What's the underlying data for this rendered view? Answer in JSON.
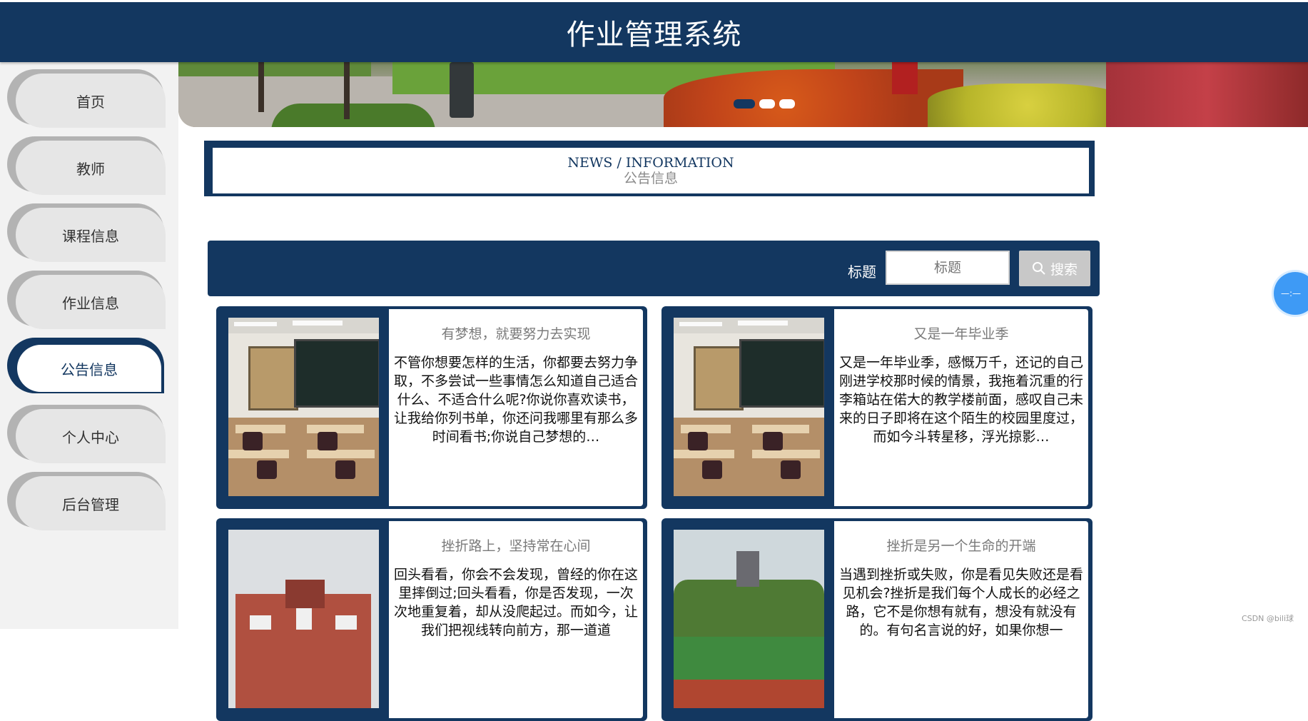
{
  "header": {
    "title": "作业管理系统"
  },
  "sidebar": {
    "items": [
      {
        "label": "首页",
        "active": false
      },
      {
        "label": "教师",
        "active": false
      },
      {
        "label": "课程信息",
        "active": false
      },
      {
        "label": "作业信息",
        "active": false
      },
      {
        "label": "公告信息",
        "active": true
      },
      {
        "label": "个人中心",
        "active": false
      },
      {
        "label": "后台管理",
        "active": false
      }
    ]
  },
  "banner": {
    "slide_count": 3,
    "active_slide": 1
  },
  "section": {
    "title_en": "NEWS / INFORMATION",
    "title_cn": "公告信息"
  },
  "search": {
    "label": "标题",
    "placeholder": "标题",
    "button_label": "搜索",
    "button_icon": "search-icon"
  },
  "cards": [
    {
      "title": "有梦想，就要努力去实现",
      "body": "不管你想要怎样的生活，你都要去努力争取，不多尝试一些事情怎么知道自己适合什么、不适合什么呢?你说你喜欢读书，让我给你列书单，你还问我哪里有那么多时间看书;你说自己梦想的…",
      "image": "classroom"
    },
    {
      "title": "又是一年毕业季",
      "body": "又是一年毕业季，感慨万千，还记的自己刚进学校那时候的情景，我拖着沉重的行李箱站在偌大的教学楼前面，感叹自己未来的日子即将在这个陌生的校园里度过，而如今斗转星移，浮光掠影…",
      "image": "classroom"
    },
    {
      "title": "挫折路上，坚持常在心间",
      "body": "回头看看，你会不会发现，曾经的你在这里摔倒过;回头看看，你是否发现，一次次地重复着，却从没爬起过。而如今，让我们把视线转向前方，那一道道",
      "image": "building"
    },
    {
      "title": "挫折是另一个生命的开端",
      "body": "当遇到挫折或失败，你是看见失败还是看见机会?挫折是我们每个人成长的必经之路，它不是你想有就有，想没有就没有的。有句名言说的好，如果你想一",
      "image": "field"
    }
  ],
  "watermark": "CSDN @bili球",
  "colors": {
    "primary": "#133760",
    "sidebar_bg": "#f2f2f2",
    "nav_inactive": "#e6e6e6"
  }
}
